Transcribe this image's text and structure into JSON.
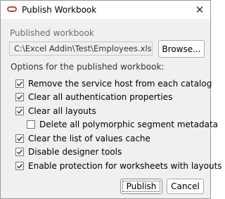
{
  "window": {
    "title": "Publish Workbook",
    "close_glyph": "✕",
    "app_icon": "oracle-logo-icon",
    "accent_color": "#c74634"
  },
  "published_workbook": {
    "label": "Published workbook",
    "path": "C:\\Excel Addin\\Test\\Employees.xlsx",
    "browse_label": "Browse..."
  },
  "options": {
    "heading": "Options for the published workbook:",
    "items": [
      {
        "label": "Remove the service host from each catalog",
        "checked": true
      },
      {
        "label": "Clear all authentication properties",
        "checked": true
      },
      {
        "label": "Clear all layouts",
        "checked": true
      },
      {
        "label": "Delete all polymorphic segment metadata",
        "checked": false
      },
      {
        "label": "Clear the list of values cache",
        "checked": true
      },
      {
        "label": "Disable designer tools",
        "checked": true
      },
      {
        "label": "Enable protection for worksheets with layouts",
        "checked": true
      }
    ]
  },
  "footer": {
    "publish_label": "Publish",
    "cancel_label": "Cancel"
  }
}
